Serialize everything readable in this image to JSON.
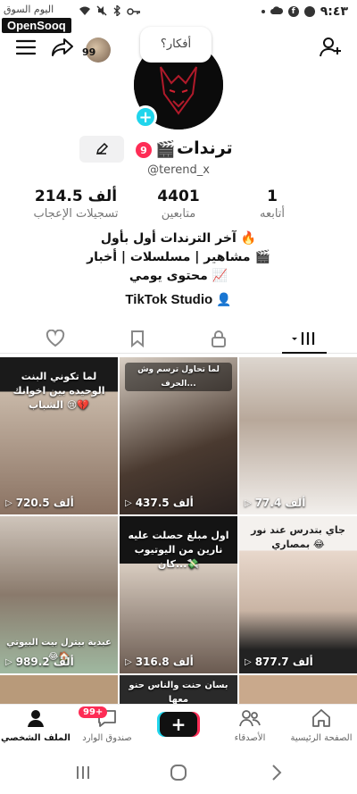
{
  "status_bar": {
    "time": "٩:٤٣",
    "watermark_top": "اليوم السوق",
    "watermark": "OpenSooq"
  },
  "header": {
    "follower_count_badge": "99",
    "bubble_text": "أفكار؟"
  },
  "profile": {
    "display_name": "ترندات",
    "notification_count": "9",
    "username": "@terend_x",
    "stats": [
      {
        "value": "214.5 ألف",
        "label": "تسجيلات الإعجاب"
      },
      {
        "value": "4401",
        "label": "متابعين"
      },
      {
        "value": "1",
        "label": "أتابعه"
      }
    ],
    "bio_lines": [
      "آخر الترندات أول بأول 🔥",
      "مشاهير | مسلسلات | أخبار 🎬",
      "محتوى يومي 📈"
    ],
    "studio_label": "TikTok Studio"
  },
  "videos": [
    {
      "caption": "لما تكوني البنت الوحيده بين اخوانك الشباب 😢💔",
      "views": "720.5 ألف",
      "bg": "#6d5a4a"
    },
    {
      "caption": "لما تحاول ترسم وش الحرف...",
      "views": "437.5 ألف",
      "bg": "#4a3a30"
    },
    {
      "caption": "",
      "views": "77.4 ألف",
      "bg": "#b8a89a"
    },
    {
      "caption": "",
      "views": "989.2 ألف",
      "bg": "#8a7a6c"
    },
    {
      "caption": "اول مبلغ حصلت عليه نارين من اليوتيوب كان...💸",
      "views": "316.8 ألف",
      "bg": "#222"
    },
    {
      "caption": "جاي بتدرس عند نور بمصاري 😂",
      "views": "877.7 ألف",
      "bg": "#c9b4a4"
    }
  ],
  "video_subcaptions": {
    "cell4": "عبدية بيترل بيت البيوتي 😂🏠",
    "cell6_top": "جاي بتدرس عند نور",
    "cell7": "بسان حنت والناس حنو معها"
  },
  "bottom_nav": {
    "items": [
      {
        "label": "الملف الشخصي"
      },
      {
        "label": "صندوق الوارد"
      },
      {
        "label": ""
      },
      {
        "label": "الأصدقاء"
      },
      {
        "label": "الصفحة الرئيسية"
      }
    ],
    "inbox_badge": "99+"
  },
  "colors": {
    "accent": "#fe2c55",
    "cyan": "#20d5ec"
  }
}
